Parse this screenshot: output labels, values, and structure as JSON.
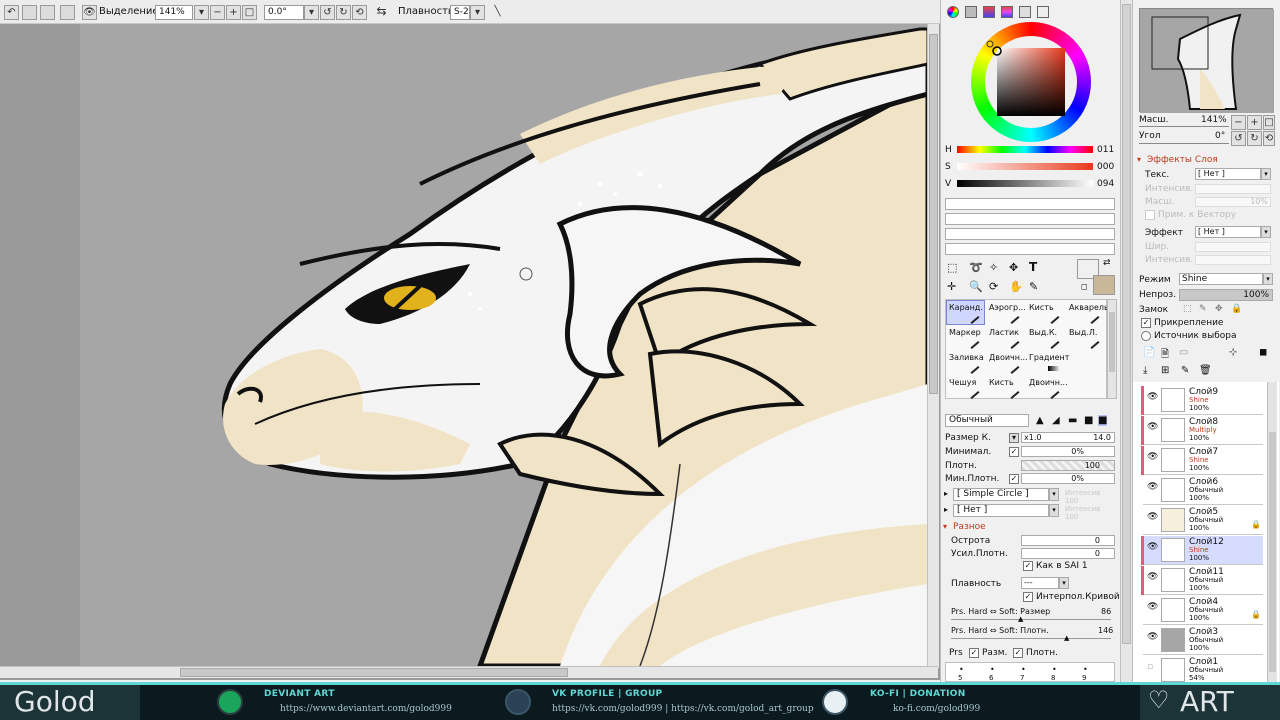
{
  "toolbar": {
    "selection_label": "Выделение",
    "zoom": "141%",
    "angle": "0.0°",
    "smoothing_label": "Плавность",
    "smoothing_value": "S-2"
  },
  "color": {
    "h_label": "H",
    "h_value": "011",
    "s_label": "S",
    "s_value": "000",
    "v_label": "V",
    "v_value": "094"
  },
  "tools": [
    {
      "label": "Каранд."
    },
    {
      "label": "Аэрогр..."
    },
    {
      "label": "Кисть"
    },
    {
      "label": "Акварель"
    },
    {
      "label": "Маркер"
    },
    {
      "label": "Ластик"
    },
    {
      "label": "Выд.К."
    },
    {
      "label": "Выд.Л."
    },
    {
      "label": "Заливка"
    },
    {
      "label": "Двоичн..."
    },
    {
      "label": "Градиент"
    },
    {
      "label": "Чешуя"
    },
    {
      "label": "Кисть"
    },
    {
      "label": "Двоичн..."
    }
  ],
  "brush": {
    "mode": "Обычный",
    "size_label": "Размер К.",
    "size_mult": "x1.0",
    "size_value": "14.0",
    "min_size_label": "Минимал.",
    "min_size_value": "0%",
    "density_label": "Плотн.",
    "density_value": "100",
    "min_density_label": "Мин.Плотн.",
    "min_density_value": "0%",
    "shape": "[ Simple Circle ]",
    "texture": "[ Нет ]",
    "shape_strength": "Интенсив",
    "texture_strength": "Интенсив",
    "shape_strength_value": "100",
    "texture_strength_value": "100",
    "misc_header": "Разное",
    "sharpness_label": "Острота",
    "sharpness_value": "0",
    "density_boost_label": "Усил.Плотн.",
    "density_boost_value": "0",
    "sai1_label": "Как в SAI 1",
    "smooth_label": "Плавность",
    "smooth_value": "---",
    "interp_label": "Интерпол.Кривой",
    "prs_size_label": "Prs. Hard ⇔ Soft: Размер",
    "prs_size_value": "86",
    "prs_density_label": "Prs. Hard ⇔ Soft: Плотн.",
    "prs_density_value": "146",
    "prs_label": "Prs",
    "prs_size_chk": "Разм.",
    "prs_density_chk": "Плотн.",
    "dot_sizes": [
      "5",
      "6",
      "7",
      "8",
      "9"
    ]
  },
  "navigator": {
    "zoom_label": "Масш.",
    "zoom_value": "141%",
    "angle_label": "Угол",
    "angle_value": "0°"
  },
  "layer_effects": {
    "header": "Эффекты Слоя",
    "texture_label": "Текс.",
    "texture_value": "[ Нет ]",
    "intensity_label": "Интенсив.",
    "scale_label": "Масш.",
    "scale_value": "10%",
    "apply_vector": "Прим. к Вектору",
    "effect_label": "Эффект",
    "effect_value": "[ Нет ]",
    "width_label": "Шир.",
    "intensity2_label": "Интенсив."
  },
  "layer_props": {
    "mode_label": "Режим",
    "mode_value": "Shine",
    "opacity_label": "Непроз.",
    "opacity_value": "100%",
    "lock_label": "Замок",
    "clip_label": "Прикрепление",
    "source_label": "Источник выбора"
  },
  "layers": [
    {
      "name": "Слой9",
      "mode": "Shine",
      "opacity": "100%",
      "clipped": true
    },
    {
      "name": "Слой8",
      "mode": "Multiply",
      "opacity": "100%",
      "clipped": true
    },
    {
      "name": "Слой7",
      "mode": "Shine",
      "opacity": "100%",
      "clipped": true
    },
    {
      "name": "Слой6",
      "mode": "Обычный",
      "opacity": "100%",
      "clipped": false
    },
    {
      "name": "Слой5",
      "mode": "Обычный",
      "opacity": "100%",
      "clipped": false
    },
    {
      "name": "Слой12",
      "mode": "Shine",
      "opacity": "100%",
      "clipped": true,
      "selected": true
    },
    {
      "name": "Слой11",
      "mode": "Обычный",
      "opacity": "100%",
      "clipped": true
    },
    {
      "name": "Слой4",
      "mode": "Обычный",
      "opacity": "100%",
      "clipped": false
    },
    {
      "name": "Слой3",
      "mode": "Обычный",
      "opacity": "100%",
      "clipped": false
    },
    {
      "name": "Слой1",
      "mode": "Обычный",
      "opacity": "54%",
      "clipped": false
    }
  ],
  "banner": {
    "brand": "Golod",
    "deviant_title": "DEVIANT ART",
    "deviant_url": "https://www.deviantart.com/golod999",
    "vk_title": "VK PROFILE | GROUP",
    "vk_url": "https://vk.com/golod999 | https://vk.com/golod_art_group",
    "kofi_title": "KO-FI | DONATION",
    "kofi_url": "ko-fi.com/golod999",
    "art_brand": "ART"
  },
  "colors": {
    "accent": "#5fd7d2",
    "selected_layer": "#d6dcff",
    "clip_bar": "#d95f7a"
  }
}
